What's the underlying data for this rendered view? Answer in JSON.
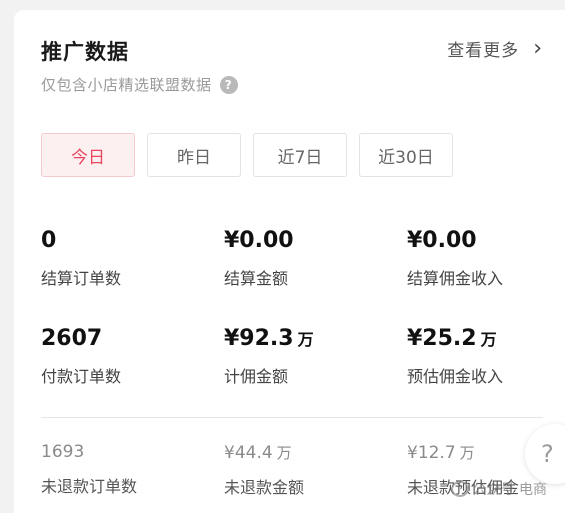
{
  "header": {
    "title": "推广数据",
    "more_label": "查看更多",
    "subtitle": "仅包含小店精选联盟数据"
  },
  "tabs": [
    {
      "label": "今日",
      "active": true
    },
    {
      "label": "昨日",
      "active": false
    },
    {
      "label": "近7日",
      "active": false
    },
    {
      "label": "近30日",
      "active": false
    }
  ],
  "metrics": {
    "settled_orders": {
      "value": "0",
      "label": "结算订单数"
    },
    "settled_amount": {
      "value": "¥0.00",
      "label": "结算金额"
    },
    "settled_commission": {
      "value": "¥0.00",
      "label": "结算佣金收入"
    },
    "paid_orders": {
      "value": "2607",
      "label": "付款订单数"
    },
    "commission_amount": {
      "value": "¥92.3",
      "unit": "万",
      "label": "计佣金额"
    },
    "estimated_commission": {
      "value": "¥25.2",
      "unit": "万",
      "label": "预估佣金收入"
    },
    "non_refund_orders": {
      "value": "1693",
      "label": "未退款订单数"
    },
    "non_refund_amount": {
      "value": "¥44.4",
      "unit": "万",
      "label": "未退款金额"
    },
    "non_refund_est_commission": {
      "value": "¥12.7",
      "unit": "万",
      "label": "未退款预估佣金"
    }
  },
  "watermark": "公众号 电商"
}
